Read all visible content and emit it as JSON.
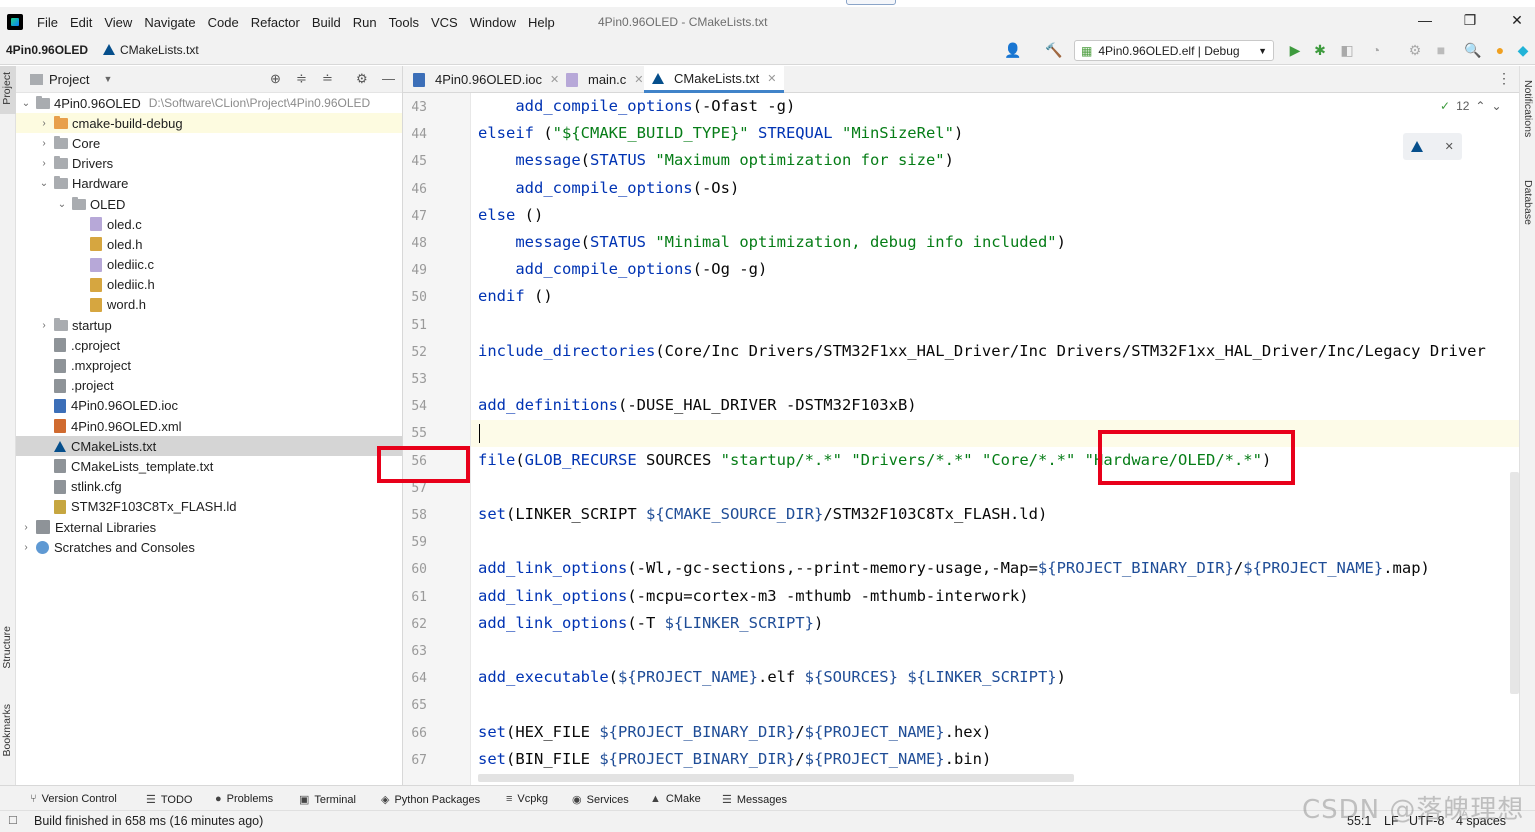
{
  "menubar": {
    "items": [
      "File",
      "Edit",
      "View",
      "Navigate",
      "Code",
      "Refactor",
      "Build",
      "Run",
      "Tools",
      "VCS",
      "Window",
      "Help"
    ],
    "window_title": "4Pin0.96OLED - CMakeLists.txt",
    "minimize": "—",
    "restore": "❐",
    "close": "✕"
  },
  "navbar": {
    "project": "4Pin0.96OLED",
    "file": "CMakeLists.txt",
    "run_config": "4Pin0.96OLED.elf | Debug"
  },
  "left_strip": {
    "project": "Project",
    "structure": "Structure",
    "bookmarks": "Bookmarks"
  },
  "right_strip": {
    "notifications": "Notifications",
    "database": "Database"
  },
  "project_panel": {
    "title": "Project",
    "root": {
      "name": "4Pin0.96OLED",
      "path": "D:\\Software\\CLion\\Project\\4Pin0.96OLED"
    },
    "tree": [
      {
        "label": "cmake-build-debug",
        "type": "folder-orange",
        "depth": 1,
        "chevron": "›"
      },
      {
        "label": "Core",
        "type": "folder",
        "depth": 1,
        "chevron": "›"
      },
      {
        "label": "Drivers",
        "type": "folder",
        "depth": 1,
        "chevron": "›"
      },
      {
        "label": "Hardware",
        "type": "folder",
        "depth": 1,
        "chevron": "⌄"
      },
      {
        "label": "OLED",
        "type": "folder",
        "depth": 2,
        "chevron": "⌄"
      },
      {
        "label": "oled.c",
        "type": "c",
        "depth": 3,
        "chevron": ""
      },
      {
        "label": "oled.h",
        "type": "h",
        "depth": 3,
        "chevron": ""
      },
      {
        "label": "olediic.c",
        "type": "c",
        "depth": 3,
        "chevron": ""
      },
      {
        "label": "olediic.h",
        "type": "h",
        "depth": 3,
        "chevron": ""
      },
      {
        "label": "word.h",
        "type": "h",
        "depth": 3,
        "chevron": ""
      },
      {
        "label": "startup",
        "type": "folder",
        "depth": 1,
        "chevron": "›"
      },
      {
        "label": ".cproject",
        "type": "txt",
        "depth": 1,
        "chevron": ""
      },
      {
        "label": ".mxproject",
        "type": "txt",
        "depth": 1,
        "chevron": ""
      },
      {
        "label": ".project",
        "type": "txt",
        "depth": 1,
        "chevron": ""
      },
      {
        "label": "4Pin0.96OLED.ioc",
        "type": "ioc",
        "depth": 1,
        "chevron": ""
      },
      {
        "label": "4Pin0.96OLED.xml",
        "type": "xml",
        "depth": 1,
        "chevron": ""
      },
      {
        "label": "CMakeLists.txt",
        "type": "cmake",
        "depth": 1,
        "chevron": "",
        "selected": true
      },
      {
        "label": "CMakeLists_template.txt",
        "type": "txt",
        "depth": 1,
        "chevron": ""
      },
      {
        "label": "stlink.cfg",
        "type": "txt",
        "depth": 1,
        "chevron": ""
      },
      {
        "label": "STM32F103C8Tx_FLASH.ld",
        "type": "ld",
        "depth": 1,
        "chevron": ""
      },
      {
        "label": "External Libraries",
        "type": "lib",
        "depth": 0,
        "chevron": "›"
      },
      {
        "label": "Scratches and Consoles",
        "type": "scr",
        "depth": 0,
        "chevron": "›"
      }
    ]
  },
  "editor": {
    "tabs": [
      {
        "label": "4Pin0.96OLED.ioc",
        "icon": "ioc"
      },
      {
        "label": "main.c",
        "icon": "c"
      },
      {
        "label": "CMakeLists.txt",
        "icon": "cmake",
        "active": true
      }
    ],
    "inspection_count": "12",
    "lines": [
      {
        "n": "43",
        "code": [
          [
            "    ",
            ""
          ],
          [
            "add_compile_options",
            "fn"
          ],
          [
            "(-Ofast -g)",
            ""
          ]
        ]
      },
      {
        "n": "44",
        "code": [
          [
            "elseif",
            "kw"
          ],
          [
            " (",
            ""
          ],
          [
            "\"${CMAKE_BUILD_TYPE}\"",
            "str"
          ],
          [
            " ",
            ""
          ],
          [
            "STREQUAL",
            "kw"
          ],
          [
            " ",
            ""
          ],
          [
            "\"MinSizeRel\"",
            "str"
          ],
          [
            ")",
            ""
          ]
        ]
      },
      {
        "n": "45",
        "code": [
          [
            "    ",
            ""
          ],
          [
            "message",
            "fn"
          ],
          [
            "(",
            ""
          ],
          [
            "STATUS",
            "kw"
          ],
          [
            " ",
            ""
          ],
          [
            "\"Maximum optimization for size\"",
            "str"
          ],
          [
            ")",
            ""
          ]
        ]
      },
      {
        "n": "46",
        "code": [
          [
            "    ",
            ""
          ],
          [
            "add_compile_options",
            "fn"
          ],
          [
            "(-Os)",
            ""
          ]
        ]
      },
      {
        "n": "47",
        "code": [
          [
            "else",
            "kw"
          ],
          [
            " ()",
            ""
          ]
        ]
      },
      {
        "n": "48",
        "code": [
          [
            "    ",
            ""
          ],
          [
            "message",
            "fn"
          ],
          [
            "(",
            ""
          ],
          [
            "STATUS",
            "kw"
          ],
          [
            " ",
            ""
          ],
          [
            "\"Minimal optimization, debug info included\"",
            "str"
          ],
          [
            ")",
            ""
          ]
        ]
      },
      {
        "n": "49",
        "code": [
          [
            "    ",
            ""
          ],
          [
            "add_compile_options",
            "fn"
          ],
          [
            "(-Og -g)",
            ""
          ]
        ]
      },
      {
        "n": "50",
        "code": [
          [
            "endif",
            "kw"
          ],
          [
            " ()",
            ""
          ]
        ]
      },
      {
        "n": "51",
        "code": []
      },
      {
        "n": "52",
        "code": [
          [
            "include_directories",
            "fn"
          ],
          [
            "(Core/Inc Drivers/STM32F1xx_HAL_Driver/Inc Drivers/STM32F1xx_HAL_Driver/Inc/Legacy Driver",
            ""
          ]
        ]
      },
      {
        "n": "53",
        "code": []
      },
      {
        "n": "54",
        "code": [
          [
            "add_definitions",
            "fn"
          ],
          [
            "(-DUSE_HAL_DRIVER -DSTM32F103xB)",
            ""
          ]
        ]
      },
      {
        "n": "55",
        "code": [],
        "current": true
      },
      {
        "n": "56",
        "code": [
          [
            "file",
            "fn"
          ],
          [
            "(",
            ""
          ],
          [
            "GLOB_RECURSE",
            "kw"
          ],
          [
            " SOURCES ",
            ""
          ],
          [
            "\"startup/*.*\"",
            "str"
          ],
          [
            " ",
            ""
          ],
          [
            "\"Drivers/*.*\"",
            "str"
          ],
          [
            " ",
            ""
          ],
          [
            "\"Core/*.*\"",
            "str"
          ],
          [
            " ",
            ""
          ],
          [
            "\"Hardware/OLED/*.*\"",
            "str"
          ],
          [
            ")",
            ""
          ]
        ]
      },
      {
        "n": "57",
        "code": []
      },
      {
        "n": "58",
        "code": [
          [
            "set",
            "fn"
          ],
          [
            "(LINKER_SCRIPT ",
            ""
          ],
          [
            "${",
            "var"
          ],
          [
            "CMAKE_SOURCE_DIR",
            "var"
          ],
          [
            "}",
            "var"
          ],
          [
            "/STM32F103C8Tx_FLASH.ld)",
            ""
          ]
        ]
      },
      {
        "n": "59",
        "code": []
      },
      {
        "n": "60",
        "code": [
          [
            "add_link_options",
            "fn"
          ],
          [
            "(-Wl,-gc-sections,--print-memory-usage,-Map=",
            ""
          ],
          [
            "${PROJECT_BINARY_DIR}",
            "var"
          ],
          [
            "/",
            ""
          ],
          [
            "${PROJECT_NAME}",
            "var"
          ],
          [
            ".map)",
            ""
          ]
        ]
      },
      {
        "n": "61",
        "code": [
          [
            "add_link_options",
            "fn"
          ],
          [
            "(-mcpu=cortex-m3 -mthumb -mthumb-interwork)",
            ""
          ]
        ]
      },
      {
        "n": "62",
        "code": [
          [
            "add_link_options",
            "fn"
          ],
          [
            "(-T ",
            ""
          ],
          [
            "${LINKER_SCRIPT}",
            "var"
          ],
          [
            ")",
            ""
          ]
        ]
      },
      {
        "n": "63",
        "code": []
      },
      {
        "n": "64",
        "code": [
          [
            "add_executable",
            "fn"
          ],
          [
            "(",
            ""
          ],
          [
            "${PROJECT_NAME}",
            "var"
          ],
          [
            ".elf ",
            ""
          ],
          [
            "${SOURCES}",
            "var"
          ],
          [
            " ",
            ""
          ],
          [
            "${LINKER_SCRIPT}",
            "var"
          ],
          [
            ")",
            ""
          ]
        ]
      },
      {
        "n": "65",
        "code": []
      },
      {
        "n": "66",
        "code": [
          [
            "set",
            "fn"
          ],
          [
            "(HEX_FILE ",
            ""
          ],
          [
            "${PROJECT_BINARY_DIR}",
            "var"
          ],
          [
            "/",
            ""
          ],
          [
            "${PROJECT_NAME}",
            "var"
          ],
          [
            ".hex)",
            ""
          ]
        ]
      },
      {
        "n": "67",
        "code": [
          [
            "set",
            "fn"
          ],
          [
            "(BIN_FILE ",
            ""
          ],
          [
            "${PROJECT_BINARY_DIR}",
            "var"
          ],
          [
            "/",
            ""
          ],
          [
            "${PROJECT_NAME}",
            "var"
          ],
          [
            ".bin)",
            ""
          ]
        ]
      }
    ]
  },
  "bottom_tools": [
    {
      "label": "Version Control",
      "icon": "⑂"
    },
    {
      "label": "TODO",
      "icon": "☰"
    },
    {
      "label": "Problems",
      "icon": "●"
    },
    {
      "label": "Terminal",
      "icon": "▣"
    },
    {
      "label": "Python Packages",
      "icon": "◈"
    },
    {
      "label": "Vcpkg",
      "icon": "≡"
    },
    {
      "label": "Services",
      "icon": "◉"
    },
    {
      "label": "CMake",
      "icon": "▲"
    },
    {
      "label": "Messages",
      "icon": "☰"
    }
  ],
  "status": {
    "message": "Build finished in 658 ms (16 minutes ago)",
    "position": "55:1",
    "line_sep": "LF",
    "encoding": "UTF-8",
    "indent": "4 spaces"
  },
  "watermark": "CSDN @落魄理想",
  "colors": {
    "keyword": "#0033b3",
    "string": "#067d17",
    "variable": "#1f4d97",
    "highlight_box": "#e8001a",
    "tab_accent": "#4083c9"
  }
}
